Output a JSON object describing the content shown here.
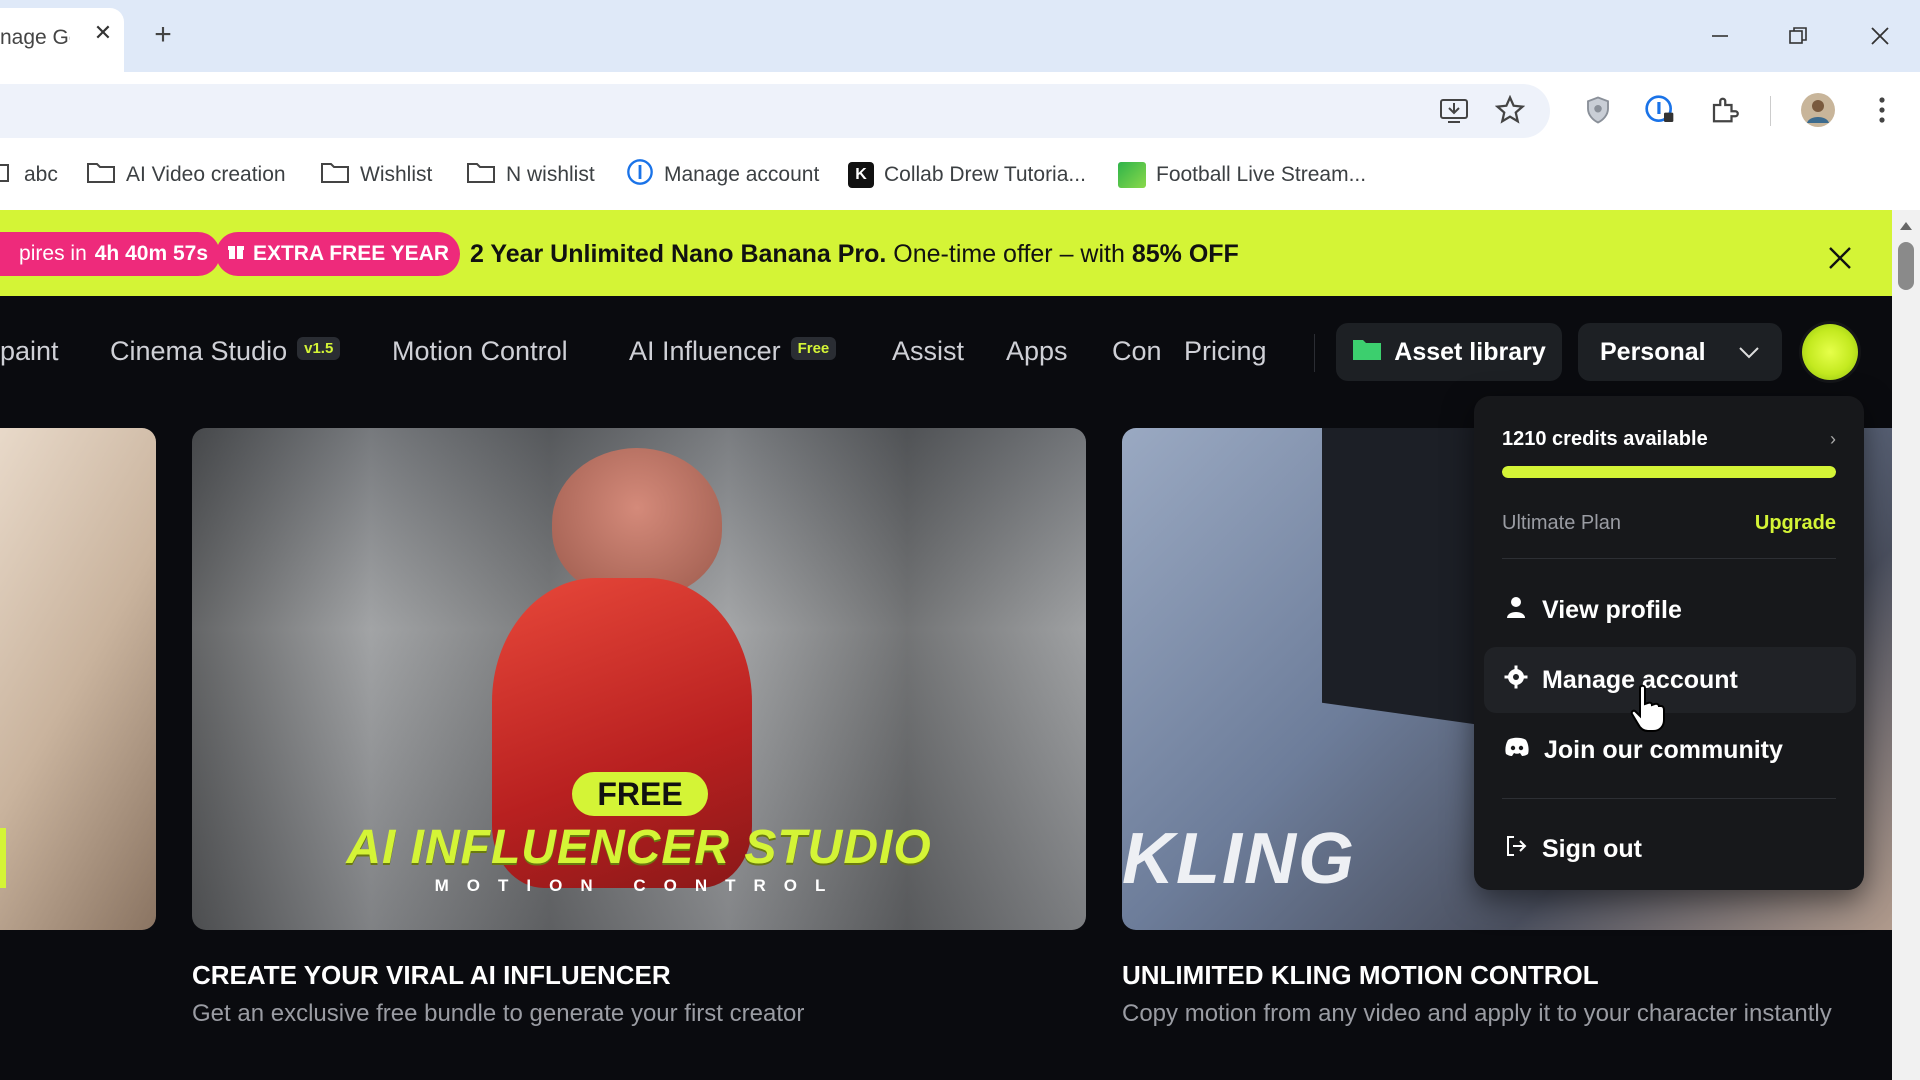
{
  "browser": {
    "tab_title": "nage Ge",
    "bookmarks": [
      {
        "label": "abc",
        "icon": "folder-icon"
      },
      {
        "label": "AI Video creation",
        "icon": "folder-icon"
      },
      {
        "label": "Wishlist",
        "icon": "folder-icon"
      },
      {
        "label": "N wishlist",
        "icon": "folder-icon"
      },
      {
        "label": "Manage account",
        "icon": "info-circle-icon"
      },
      {
        "label": "Collab Drew Tutoria...",
        "icon": "k-logo-icon"
      },
      {
        "label": "Football Live Stream...",
        "icon": "stream-logo-icon"
      }
    ]
  },
  "promo": {
    "timer_prefix": "pires in",
    "timer_value": "4h 40m 57s",
    "extra_label": "EXTRA FREE YEAR",
    "headline": "2 Year Unlimited Nano Banana Pro.",
    "offer_prefix": "One-time offer – with",
    "offer_value": "85% OFF"
  },
  "nav": {
    "items": [
      {
        "label": "paint"
      },
      {
        "label": "Cinema Studio",
        "badge": "v1.5"
      },
      {
        "label": "Motion Control"
      },
      {
        "label": "AI Influencer",
        "badge": "Free"
      },
      {
        "label": "Assist"
      },
      {
        "label": "Apps"
      },
      {
        "label": "Con"
      },
      {
        "label": "Pricing"
      }
    ],
    "asset_library": "Asset library",
    "workspace": "Personal"
  },
  "cards": [
    {
      "title": "CREATE YOUR VIRAL AI INFLUENCER",
      "description": "Get an exclusive free bundle to generate your first creator",
      "overlay_badge": "FREE",
      "overlay_title": "AI INFLUENCER STUDIO",
      "overlay_subtitle": "MOTION CONTROL"
    },
    {
      "title": "UNLIMITED KLING MOTION CONTROL",
      "description": "Copy motion from any video and apply it to your character instantly",
      "overlay_title": "KLING"
    }
  ],
  "account_menu": {
    "credits": "1210 credits available",
    "credits_fraction": 1.0,
    "plan": "Ultimate Plan",
    "upgrade": "Upgrade",
    "items": [
      {
        "label": "View profile",
        "icon": "user-icon"
      },
      {
        "label": "Manage account",
        "icon": "gear-icon"
      },
      {
        "label": "Join our community",
        "icon": "discord-icon"
      }
    ],
    "sign_out": "Sign out"
  },
  "colors": {
    "accent_lime": "#d4f436",
    "promo_pink": "#ee2a7b",
    "site_bg": "#0a0b0f"
  }
}
